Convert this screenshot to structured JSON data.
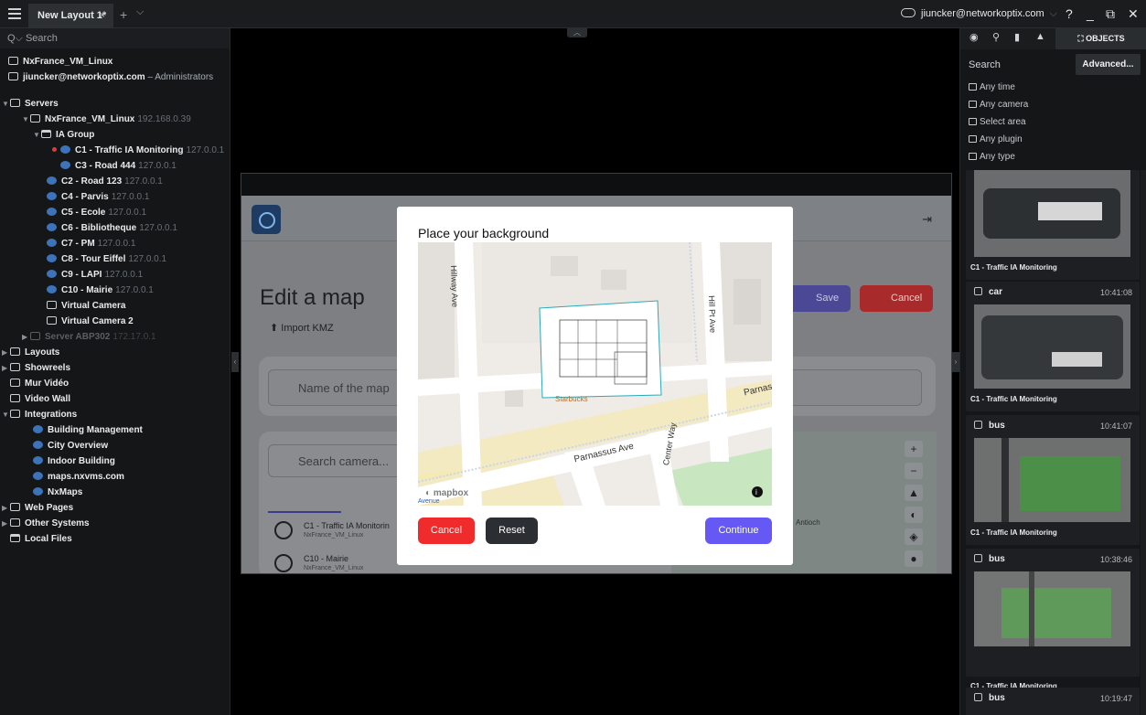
{
  "titlebar": {
    "tab_label": "New Layout 1*",
    "tab_close": "×",
    "new_tab": "+",
    "tabs_menu": "⌵",
    "user": "jiuncker@networkoptix.com",
    "help": "?",
    "minimize": "_",
    "restore": "⧉",
    "close": "✕"
  },
  "left": {
    "search_placeholder": "Search",
    "system_name": "NxFrance_VM_Linux",
    "user_name": "jiuncker@networkoptix.com",
    "user_role": "– Administrators",
    "servers": "Servers",
    "server_name": "NxFrance_VM_Linux",
    "server_ip": "192.168.0.39",
    "group": "IA Group",
    "cameras": [
      {
        "name": "C1 - Traffic IA Monitoring",
        "ip": "127.0.0.1"
      },
      {
        "name": "C3 - Road 444",
        "ip": "127.0.0.1"
      },
      {
        "name": "C2 - Road 123",
        "ip": "127.0.0.1"
      },
      {
        "name": "C4 - Parvis",
        "ip": "127.0.0.1"
      },
      {
        "name": "C5 - Ecole",
        "ip": "127.0.0.1"
      },
      {
        "name": "C6 - Bibliotheque",
        "ip": "127.0.0.1"
      },
      {
        "name": "C7 - PM",
        "ip": "127.0.0.1"
      },
      {
        "name": "C8 - Tour Eiffel",
        "ip": "127.0.0.1"
      },
      {
        "name": "C9 - LAPI",
        "ip": "127.0.0.1"
      },
      {
        "name": "C10 - Mairie",
        "ip": "127.0.0.1"
      }
    ],
    "virtual_1": "Virtual Camera",
    "virtual_2": "Virtual Camera 2",
    "server2_name": "Server ABP302",
    "server2_ip": "172.17.0.1",
    "layouts": "Layouts",
    "showreels": "Showreels",
    "mur_video": "Mur Vidéo",
    "video_wall": "Video Wall",
    "integrations": "Integrations",
    "integration_items": [
      "Building Management",
      "City Overview",
      "Indoor Building",
      "maps.nxvms.com",
      "NxMaps"
    ],
    "web_pages": "Web Pages",
    "other_systems": "Other Systems",
    "local_files": "Local Files"
  },
  "background_app": {
    "title": "Edit a map",
    "import": "Import KMZ",
    "save": "Save",
    "cancel": "Cancel",
    "name_placeholder": "Name of the map",
    "search_placeholder": "Search camera...",
    "camera_1": "C1 - Traffic IA Monitorin",
    "camera_1_sub": "NxFrance_VM_Linux",
    "camera_2": "C10 - Mairie",
    "camera_2_sub": "NxFrance_VM_Linux",
    "map_label": "Antioch"
  },
  "modal": {
    "title": "Place your background",
    "cancel": "Cancel",
    "reset": "Reset",
    "continue": "Continue",
    "map_labels": {
      "hillway": "Hillway Ave",
      "hillpt": "Hill Pt Ave",
      "parnassus_1": "Parnassus Ave",
      "parnassus_2": "Parnas",
      "center": "Center Way",
      "starbucks": "Starbucks",
      "mapbox": "mapbox",
      "avenue": "Avenue"
    }
  },
  "right": {
    "objects_tab": "OBJECTS",
    "search": "Search",
    "advanced": "Advanced...",
    "filters": [
      "Any time",
      "Any camera",
      "Select area",
      "Any plugin",
      "Any type"
    ],
    "results": [
      {
        "type": "",
        "time": "",
        "camera": "C1 - Traffic IA Monitoring"
      },
      {
        "type": "car",
        "time": "10:41:08",
        "camera": "C1 - Traffic IA Monitoring"
      },
      {
        "type": "bus",
        "time": "10:41:07",
        "camera": "C1 - Traffic IA Monitoring"
      },
      {
        "type": "bus",
        "time": "10:38:46",
        "camera": "C1 - Traffic IA Monitoring"
      },
      {
        "type": "bus",
        "time": "10:19:47",
        "camera": ""
      }
    ]
  },
  "colors": {
    "accent": "#6558f5",
    "danger": "#ef2b2b",
    "recording": "#e53935"
  }
}
